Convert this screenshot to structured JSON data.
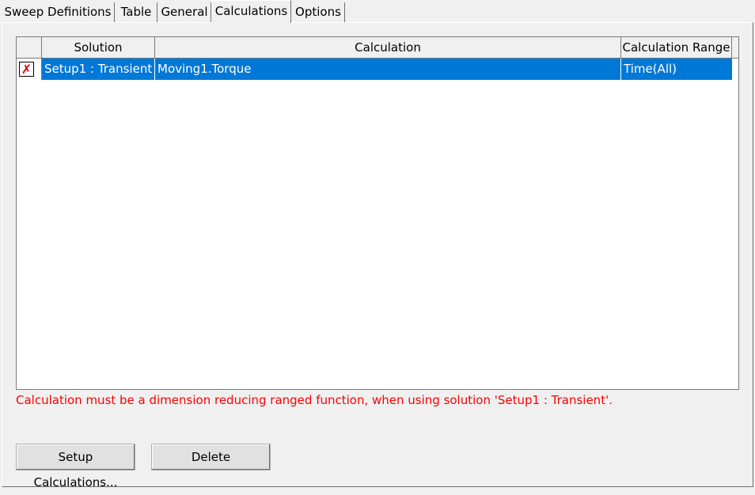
{
  "tabs": [
    {
      "label": "Sweep Definitions"
    },
    {
      "label": "Table"
    },
    {
      "label": "General"
    },
    {
      "label": "Calculations"
    },
    {
      "label": "Options"
    }
  ],
  "active_tab": "Calculations",
  "grid": {
    "columns": [
      "",
      "Solution",
      "Calculation",
      "Calculation Range"
    ],
    "rows": [
      {
        "checked_icon": "x-mark-icon",
        "solution": "Setup1 : Transient",
        "calculation": "Moving1.Torque",
        "range": "Time(All)",
        "selected": true
      }
    ]
  },
  "error_message": "Calculation must be a dimension reducing ranged function, when using solution 'Setup1 : Transient'.",
  "buttons": {
    "setup": "Setup Calculations...",
    "delete": "Delete"
  },
  "colors": {
    "selection": "#0078d7",
    "error": "#ff0000"
  }
}
